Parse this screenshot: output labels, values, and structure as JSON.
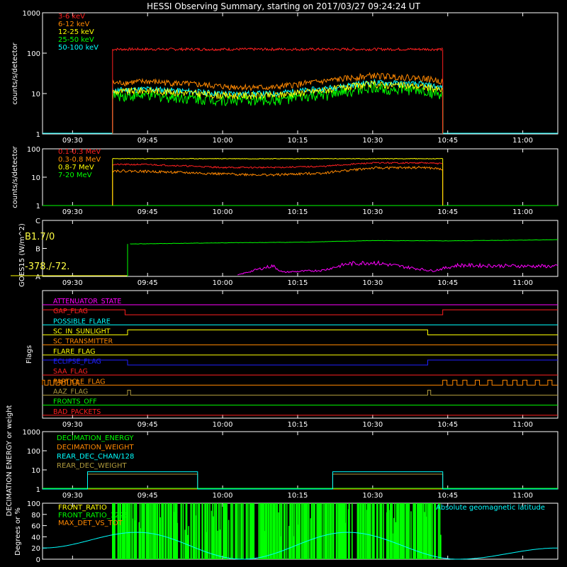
{
  "title": "HESSI Observing Summary, starting on 2017/03/27 09:24:24 UT",
  "x_tick_labels": [
    "09:30",
    "09:45",
    "10:00",
    "10:15",
    "10:30",
    "10:45",
    "11:00"
  ],
  "colors": {
    "red": "#ff2020",
    "orange": "#ff8800",
    "yellow": "#ffff00",
    "green": "#00ff00",
    "cyan": "#00ffff",
    "magenta": "#ff00ff",
    "blue": "#2020ff",
    "olive": "#b09a3c",
    "pink": "#ff44aa",
    "axis": "#ffffff"
  },
  "chart_data": [
    {
      "type": "line",
      "panel": "hessi-lo",
      "ylabel": "counts/s/detector",
      "log": true,
      "ylim": [
        1,
        1000
      ],
      "y_tick_labels": [
        "1",
        "10",
        "100",
        "1000"
      ],
      "x_range": [
        "09:24",
        "11:07"
      ],
      "data_window": [
        "09:38",
        "10:44"
      ],
      "series": [
        {
          "name": "3-6 keV",
          "color": "red",
          "x": [
            "09:38",
            "09:50",
            "10:00",
            "10:10",
            "10:20",
            "10:30",
            "10:40",
            "10:44"
          ],
          "values": [
            125,
            125,
            125,
            125,
            125,
            125,
            125,
            125
          ]
        },
        {
          "name": "6-12 keV",
          "color": "orange",
          "x": [
            "09:38",
            "09:45",
            "10:00",
            "10:10",
            "10:20",
            "10:30",
            "10:40",
            "10:44"
          ],
          "values": [
            18,
            20,
            15,
            14,
            20,
            28,
            24,
            20
          ]
        },
        {
          "name": "12-25 keV",
          "color": "yellow",
          "x": [
            "09:38",
            "09:45",
            "10:00",
            "10:10",
            "10:20",
            "10:30",
            "10:40",
            "10:44"
          ],
          "values": [
            11,
            12,
            9,
            9,
            12,
            17,
            15,
            12
          ]
        },
        {
          "name": "25-50 keV",
          "color": "green",
          "x": [
            "09:38",
            "09:45",
            "10:00",
            "10:10",
            "10:20",
            "10:30",
            "10:40",
            "10:44"
          ],
          "values": [
            9,
            9,
            7,
            7,
            9,
            14,
            12,
            9
          ]
        },
        {
          "name": "50-100 keV",
          "color": "cyan",
          "x": [
            "09:38",
            "09:45",
            "10:00",
            "10:10",
            "10:20",
            "10:30",
            "10:40",
            "10:44"
          ],
          "values": [
            12,
            13,
            10,
            10,
            13,
            19,
            17,
            14
          ]
        }
      ]
    },
    {
      "type": "line",
      "panel": "hessi-hi",
      "ylabel": "counts/s/detector",
      "log": true,
      "ylim": [
        1,
        100
      ],
      "y_tick_labels": [
        "1",
        "10",
        "100"
      ],
      "x_range": [
        "09:24",
        "11:07"
      ],
      "data_window": [
        "09:38",
        "10:44"
      ],
      "series": [
        {
          "name": "0.1-0.3 MeV",
          "color": "red",
          "x": [
            "09:38",
            "09:45",
            "10:00",
            "10:10",
            "10:20",
            "10:30",
            "10:40",
            "10:44"
          ],
          "values": [
            28,
            28,
            22,
            22,
            24,
            32,
            32,
            30
          ]
        },
        {
          "name": "0.3-0.8 MeV",
          "color": "orange",
          "x": [
            "09:38",
            "09:45",
            "10:00",
            "10:10",
            "10:20",
            "10:30",
            "10:40",
            "10:44"
          ],
          "values": [
            17,
            16,
            13,
            12,
            14,
            21,
            22,
            19
          ]
        },
        {
          "name": "0.8-7 MeV",
          "color": "yellow",
          "x": [
            "09:38",
            "10:00",
            "10:20",
            "10:44"
          ],
          "values": [
            45,
            45,
            45,
            45
          ]
        },
        {
          "name": "7-20 MeV",
          "color": "green",
          "x": [
            "09:24",
            "11:07"
          ],
          "values": [
            1,
            1
          ]
        }
      ]
    },
    {
      "type": "line",
      "panel": "goes",
      "ylabel": "GOES15 (W/m^2)",
      "y_tick_labels": [
        "A",
        "B",
        "C"
      ],
      "annotations": [
        "B1.7/0",
        "-378./-72."
      ],
      "x_range": [
        "09:24",
        "11:07"
      ],
      "series": [
        {
          "name": "",
          "color": "green",
          "x": [
            "09:24",
            "09:41",
            "09:41.5",
            "10:00",
            "10:15",
            "10:30",
            "10:45",
            "11:07"
          ],
          "values": [
            0.0,
            0.0,
            1.16,
            1.2,
            1.22,
            1.28,
            1.27,
            1.31
          ]
        },
        {
          "name": "",
          "color": "magenta",
          "x": [
            "10:03",
            "10:07",
            "10:10",
            "10:12",
            "10:20",
            "10:25",
            "10:30",
            "10:38",
            "10:42",
            "10:47",
            "10:55",
            "11:07"
          ],
          "values": [
            0.05,
            0.25,
            0.38,
            0.15,
            0.22,
            0.45,
            0.5,
            0.3,
            0.2,
            0.4,
            0.38,
            0.36
          ]
        }
      ]
    },
    {
      "type": "line",
      "panel": "flags",
      "ylabel": "Flags",
      "x_range": [
        "09:24",
        "11:07"
      ],
      "flags": [
        {
          "name": "ATTENUATOR_STATE",
          "color": "magenta"
        },
        {
          "name": "GAP_FLAG",
          "color": "red"
        },
        {
          "name": "POSSIBLE_FLARE",
          "color": "cyan"
        },
        {
          "name": "SC_IN_SUNLIGHT",
          "color": "yellow"
        },
        {
          "name": "SC_TRANSMITTER",
          "color": "orange"
        },
        {
          "name": "FLARE_FLAG",
          "color": "yellow"
        },
        {
          "name": "ECLIPSE_FLAG",
          "color": "blue"
        },
        {
          "name": "SAA_FLAG",
          "color": "red"
        },
        {
          "name": "PARTICLE_FLAG",
          "color": "orange"
        },
        {
          "name": "AAZ_FLAG",
          "color": "olive"
        },
        {
          "name": "FRONTS_OFF",
          "color": "green"
        },
        {
          "name": "BAD_PACKETS",
          "color": "red"
        }
      ]
    },
    {
      "type": "line",
      "panel": "decimation",
      "ylabel": "DECIMATION ENERGY or weight",
      "log": true,
      "ylim": [
        1,
        1000
      ],
      "y_tick_labels": [
        "1",
        "10",
        "100",
        "1000"
      ],
      "x_range": [
        "09:24",
        "11:07"
      ],
      "series": [
        {
          "name": "DECIMATION_ENERGY",
          "color": "green",
          "x": [
            "09:24",
            "11:07"
          ],
          "values": [
            1,
            1
          ]
        },
        {
          "name": "DECIMATION_WEIGHT",
          "color": "orange",
          "x": [
            "09:24",
            "11:07"
          ],
          "values": [
            1,
            1
          ]
        },
        {
          "name": "REAR_DEC_CHAN/128",
          "color": "cyan",
          "x": [
            "09:24",
            "09:33",
            "09:33",
            "09:55",
            "09:55",
            "10:22",
            "10:22",
            "10:44",
            "10:44",
            "11:07"
          ],
          "values": [
            1,
            1,
            8,
            8,
            1,
            1,
            8,
            8,
            1,
            1
          ]
        },
        {
          "name": "REAR_DEC_WEIGHT",
          "color": "olive",
          "x": [
            "09:24",
            "09:33",
            "09:33",
            "09:55",
            "09:55",
            "10:22",
            "10:22",
            "10:44",
            "10:44",
            "11:07"
          ],
          "values": [
            1,
            1,
            6,
            6,
            1,
            1,
            6,
            6,
            1,
            1
          ]
        }
      ]
    },
    {
      "type": "line",
      "panel": "ratio",
      "ylabel": "Degrees or %",
      "ylim": [
        0,
        100
      ],
      "y_tick_labels": [
        "0",
        "20",
        "40",
        "60",
        "80",
        "100"
      ],
      "x_range": [
        "09:24",
        "11:07"
      ],
      "series": [
        {
          "name": "FRONT_RATIO",
          "color": "yellow",
          "x": [],
          "values": []
        },
        {
          "name": "FRONT_RATIO_1225",
          "color": "green",
          "x": [
            "09:38",
            "10:44"
          ],
          "values": [
            100,
            100
          ]
        },
        {
          "name": "MAX_DET_VS_TOT",
          "color": "orange",
          "x": [],
          "values": []
        },
        {
          "name": "Absolute geomagnetic latitude",
          "color": "cyan",
          "x": [
            "09:24",
            "09:43",
            "10:04",
            "10:25",
            "10:47",
            "11:07"
          ],
          "values": [
            20,
            48,
            0,
            48,
            0,
            20
          ]
        }
      ]
    }
  ]
}
